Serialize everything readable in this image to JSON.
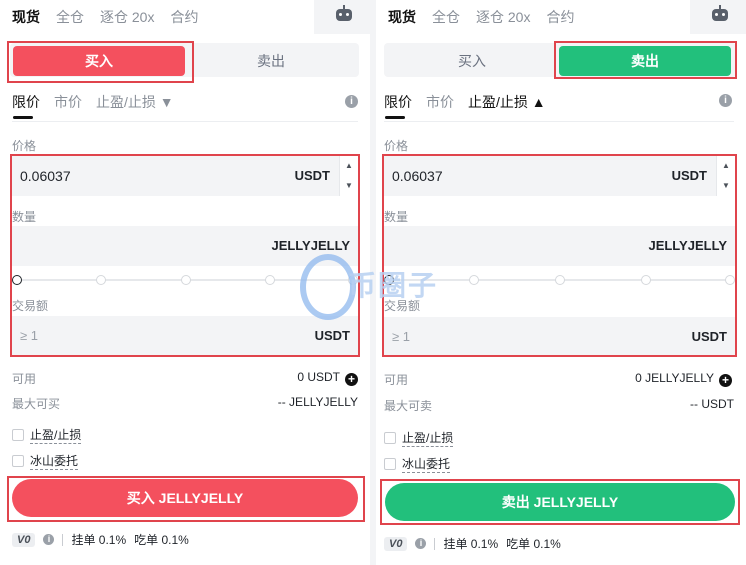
{
  "trade_mode_tabs": [
    "现货",
    "全仓",
    "逐仓 20x",
    "合约"
  ],
  "left": {
    "side_buy": "买入",
    "side_sell": "卖出",
    "order_types": {
      "limit": "限价",
      "market": "市价",
      "tpsl": "止盈/止损 ▼"
    },
    "price_label": "价格",
    "price_value": "0.06037",
    "price_unit": "USDT",
    "amount_label": "数量",
    "amount_unit": "JELLYJELLY",
    "total_label": "交易额",
    "total_placeholder": "≥ 1",
    "total_unit": "USDT",
    "available_label": "可用",
    "available_value": "0 USDT",
    "max_label": "最大可买",
    "max_value": "-- JELLYJELLY",
    "opt_tpsl": "止盈/止损",
    "opt_iceberg": "冰山委托",
    "submit": "买入 JELLYJELLY",
    "vip": "V0",
    "maker_fee": "挂单 0.1%",
    "taker_fee": "吃单 0.1%"
  },
  "right": {
    "side_buy": "买入",
    "side_sell": "卖出",
    "order_types": {
      "limit": "限价",
      "market": "市价",
      "tpsl": "止盈/止损 ▲"
    },
    "price_label": "价格",
    "price_value": "0.06037",
    "price_unit": "USDT",
    "amount_label": "数量",
    "amount_unit": "JELLYJELLY",
    "total_label": "交易额",
    "total_placeholder": "≥ 1",
    "total_unit": "USDT",
    "available_label": "可用",
    "available_value": "0 JELLYJELLY",
    "max_label": "最大可卖",
    "max_value": "-- USDT",
    "opt_tpsl": "止盈/止损",
    "opt_iceberg": "冰山委托",
    "submit": "卖出 JELLYJELLY",
    "vip": "V0",
    "maker_fee": "挂单 0.1%",
    "taker_fee": "吃单 0.1%"
  },
  "watermark_text": "币圈子",
  "colors": {
    "buy": "#f4505e",
    "sell": "#22c07c",
    "highlight_box": "#e0444c"
  }
}
